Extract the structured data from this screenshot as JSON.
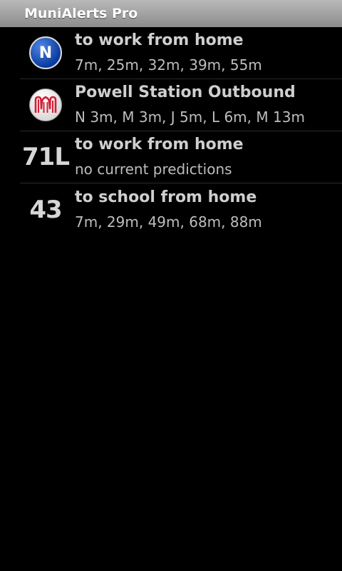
{
  "app": {
    "title": "MuniAlerts Pro"
  },
  "colors": {
    "titlebar": "#9e9e9e",
    "background": "#000000",
    "muni_red": "#d21f35",
    "n_line_blue": "#1f5bc8"
  },
  "alerts": [
    {
      "icon": "n-line-icon",
      "icon_label": "N",
      "title": "to work from home",
      "predictions": "7m, 25m, 32m, 39m, 55m"
    },
    {
      "icon": "muni-logo-icon",
      "title": "Powell Station Outbound",
      "predictions": "N 3m, M 3m, J 5m, L 6m, M 13m"
    },
    {
      "route": "71L",
      "title": "to work from home",
      "predictions": "no current predictions"
    },
    {
      "route": "43",
      "title": "to school from home",
      "predictions": "7m, 29m, 49m, 68m, 88m"
    }
  ]
}
